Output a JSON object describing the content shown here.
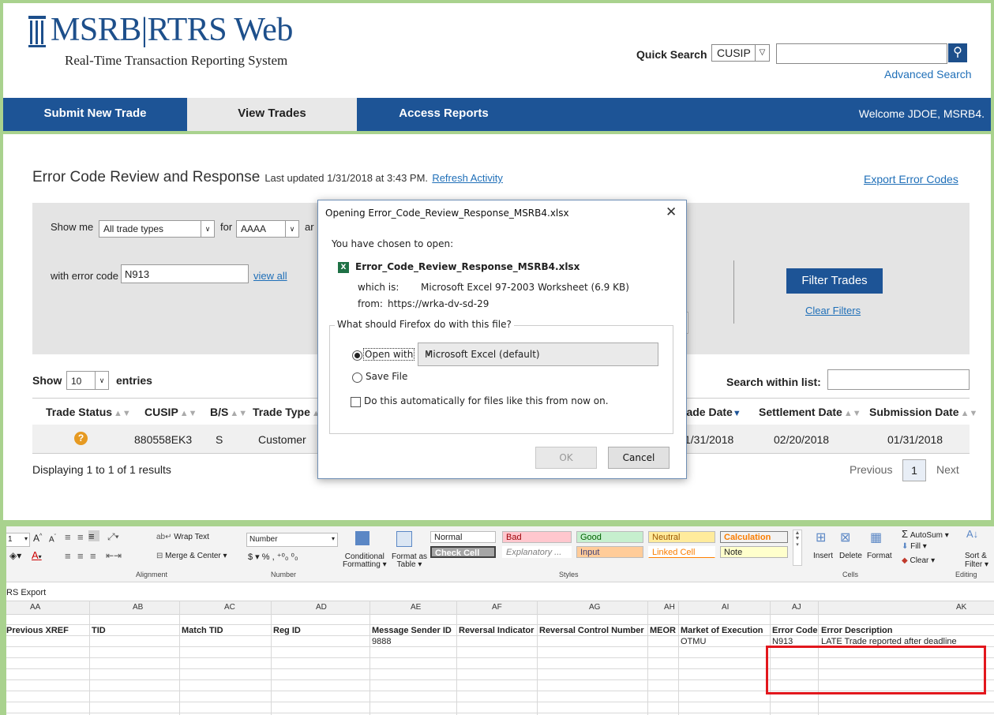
{
  "header": {
    "logo_title": "MSRB|RTRS Web",
    "logo_subtitle": "Real-Time Transaction Reporting System",
    "quick_search_label": "Quick Search",
    "quick_search_type": "CUSIP",
    "advanced_search": "Advanced Search"
  },
  "nav": {
    "submit": "Submit New Trade",
    "view": "View Trades",
    "reports": "Access Reports",
    "welcome": "Welcome JDOE, MSRB4."
  },
  "page": {
    "title": "Error Code Review and Response",
    "updated": "Last updated 1/31/2018 at 3:43 PM.",
    "refresh": "Refresh Activity",
    "export": "Export Error Codes"
  },
  "filters": {
    "show_me": "Show me",
    "trade_types": "All trade types",
    "for": "for",
    "dealer": "AAAA",
    "and_partial": "ar",
    "error_code_label": "with error code",
    "error_code_value": "N913",
    "view_all": "view all",
    "filter_button": "Filter Trades",
    "clear": "Clear Filters"
  },
  "table": {
    "show": "Show",
    "entries_value": "10",
    "entries": "entries",
    "search_label": "Search within list:",
    "columns": [
      "Trade Status",
      "CUSIP",
      "B/S",
      "Trade Type",
      "rade Date",
      "Settlement Date",
      "Submission Date"
    ],
    "row": {
      "cusip": "880558EK3",
      "bs": "S",
      "type": "Customer",
      "trade_date": "1/31/2018",
      "settlement": "02/20/2018",
      "submission": "01/31/2018"
    },
    "displaying": "Displaying 1 to 1 of 1 results",
    "previous": "Previous",
    "page": "1",
    "next": "Next"
  },
  "dialog": {
    "title": "Opening Error_Code_Review_Response_MSRB4.xlsx",
    "chosen": "You have chosen to open:",
    "filename": "Error_Code_Review_Response_MSRB4.xlsx",
    "which_label": "which is:",
    "which_value": "Microsoft Excel 97-2003 Worksheet (6.9 KB)",
    "from_label": "from:",
    "from_value": "https://wrka-dv-sd-29",
    "question": "What should Firefox do with this file?",
    "open_with": "Open with",
    "app": "Microsoft Excel (default)",
    "save_file": "Save File",
    "auto": "Do this automatically for files like this from now on.",
    "ok": "OK",
    "cancel": "Cancel"
  },
  "excel": {
    "font_size": "1",
    "wrap_text": "Wrap Text",
    "merge_center": "Merge & Center",
    "number_format": "Number",
    "conditional": "Conditional",
    "formatting": "Formatting",
    "format_as": "Format as",
    "table": "Table",
    "styles": [
      "Normal",
      "Bad",
      "Good",
      "Neutral",
      "Calculation",
      "Check Cell",
      "Explanatory ...",
      "Input",
      "Linked Cell",
      "Note"
    ],
    "insert": "Insert",
    "delete": "Delete",
    "format": "Format",
    "autosum": "AutoSum",
    "fill": "Fill",
    "clear": "Clear",
    "sort": "Sort &",
    "filter": "Filter",
    "groups": [
      "Alignment",
      "Number",
      "Styles",
      "Cells",
      "Editing"
    ],
    "sheet_label": "RS Export",
    "col_letters": [
      "AA",
      "AB",
      "AC",
      "AD",
      "AE",
      "AF",
      "AG",
      "AH",
      "AI",
      "AJ",
      "AK"
    ],
    "headers": [
      "Previous XREF",
      "TID",
      "Match TID",
      "Reg ID",
      "Message Sender ID",
      "Reversal Indicator",
      "Reversal Control Number",
      "MEOR",
      "Market of Execution",
      "Error Code",
      "Error Description"
    ],
    "row1": {
      "sender": "9888",
      "market": "OTMU",
      "error_code": "N913",
      "error_desc": "LATE Trade reported after deadline"
    }
  }
}
